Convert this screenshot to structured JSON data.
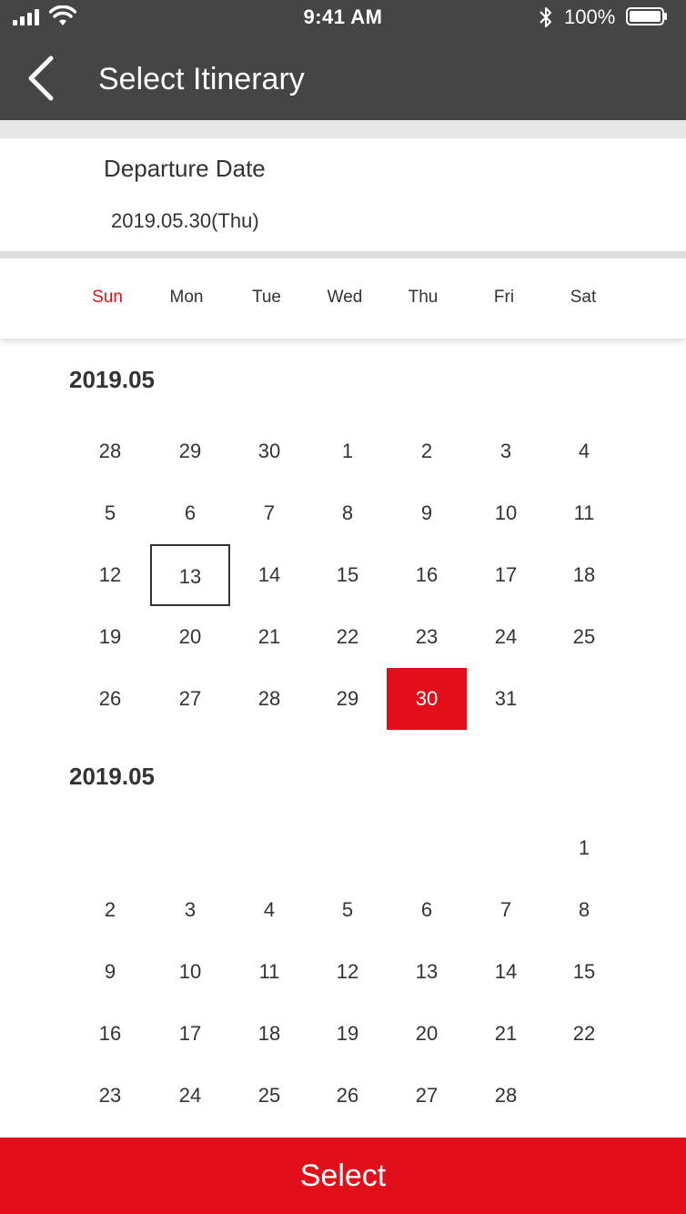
{
  "status_bar": {
    "time": "9:41 AM",
    "battery": "100%"
  },
  "nav": {
    "title": "Select Itinerary"
  },
  "departure": {
    "label": "Departure Date",
    "value": "2019.05.30(Thu)"
  },
  "weekdays": [
    "Sun",
    "Mon",
    "Tue",
    "Wed",
    "Thu",
    "Fri",
    "Sat"
  ],
  "colors": {
    "accent": "#e20f1a",
    "header": "#454545"
  },
  "months": [
    {
      "title": "2019.05",
      "weeks": [
        [
          "28",
          "29",
          "30",
          "1",
          "2",
          "3",
          "4"
        ],
        [
          "5",
          "6",
          "7",
          "8",
          "9",
          "10",
          "11"
        ],
        [
          "12",
          "13",
          "14",
          "15",
          "16",
          "17",
          "18"
        ],
        [
          "19",
          "20",
          "21",
          "22",
          "23",
          "24",
          "25"
        ],
        [
          "26",
          "27",
          "28",
          "29",
          "30",
          "31",
          ""
        ]
      ],
      "today": "13",
      "selected": "30"
    },
    {
      "title": "2019.05",
      "weeks": [
        [
          "",
          "",
          "",
          "",
          "",
          "",
          "1"
        ],
        [
          "2",
          "3",
          "4",
          "5",
          "6",
          "7",
          "8"
        ],
        [
          "9",
          "10",
          "11",
          "12",
          "13",
          "14",
          "15"
        ],
        [
          "16",
          "17",
          "18",
          "19",
          "20",
          "21",
          "22"
        ],
        [
          "23",
          "24",
          "25",
          "26",
          "27",
          "28",
          ""
        ]
      ]
    }
  ],
  "select_button": "Select"
}
